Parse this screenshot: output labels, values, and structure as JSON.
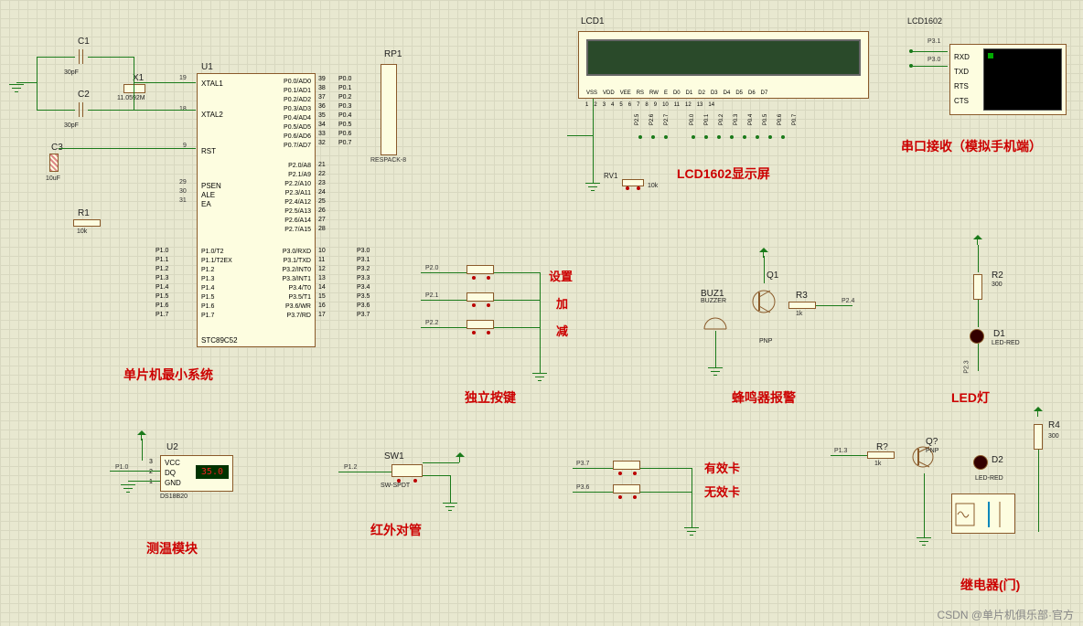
{
  "titles": {
    "mcu": "单片机最小系统",
    "lcd": "LCD1602显示屏",
    "serial": "串口接收（模拟手机端）",
    "buttons": "独立按键",
    "buzzer": "蜂鸣器报警",
    "led": "LED灯",
    "temp": "测温模块",
    "ir": "红外对管",
    "relay": "继电器(门)",
    "cardValid": "有效卡",
    "cardInvalid": "无效卡",
    "btnSet": "设置",
    "btnAdd": "加",
    "btnSub": "减"
  },
  "components": {
    "C1": {
      "ref": "C1",
      "value": "30pF"
    },
    "C2": {
      "ref": "C2",
      "value": "30pF"
    },
    "C3": {
      "ref": "C3",
      "value": "10uF"
    },
    "X1": {
      "ref": "X1",
      "value": "11.0592M"
    },
    "R1": {
      "ref": "R1",
      "value": "10k"
    },
    "R2": {
      "ref": "R2",
      "value": "300"
    },
    "R3": {
      "ref": "R3",
      "value": "1k"
    },
    "R4": {
      "ref": "R4",
      "value": "300"
    },
    "Rq": {
      "ref": "R?",
      "value": "1k"
    },
    "RV1": {
      "ref": "RV1",
      "value": "10k"
    },
    "RP1": {
      "ref": "RP1",
      "value": "RESPACK-8"
    },
    "U1": {
      "ref": "U1",
      "part": "STC89C52"
    },
    "U2": {
      "ref": "U2",
      "part": "DS18B20",
      "display": "35.0"
    },
    "LCD1": {
      "ref": "LCD1",
      "part": "LCD1602"
    },
    "D1": {
      "ref": "D1",
      "value": "LED-RED"
    },
    "D2": {
      "ref": "D2",
      "value": "LED-RED"
    },
    "Q1": {
      "ref": "Q1",
      "value": "PNP"
    },
    "Qq": {
      "ref": "Q?",
      "value": "PNP"
    },
    "BUZ1": {
      "ref": "BUZ1",
      "value": "BUZZER"
    },
    "SW1": {
      "ref": "SW1",
      "value": "SW-SPDT"
    }
  },
  "mcuPins": {
    "left": [
      {
        "num": "19",
        "name": "XTAL1"
      },
      {
        "num": "18",
        "name": "XTAL2"
      },
      {
        "num": "9",
        "name": "RST"
      },
      {
        "num": "29",
        "name": "PSEN"
      },
      {
        "num": "30",
        "name": "ALE"
      },
      {
        "num": "31",
        "name": "EA"
      },
      {
        "num": "",
        "name": "P1.0/T2"
      },
      {
        "num": "",
        "name": "P1.1/T2EX"
      },
      {
        "num": "",
        "name": "P1.2"
      },
      {
        "num": "",
        "name": "P1.3"
      },
      {
        "num": "",
        "name": "P1.4"
      },
      {
        "num": "",
        "name": "P1.5"
      },
      {
        "num": "",
        "name": "P1.6"
      },
      {
        "num": "",
        "name": "P1.7"
      }
    ],
    "right": [
      {
        "num": "39",
        "name": "P0.0/AD0"
      },
      {
        "num": "38",
        "name": "P0.1/AD1"
      },
      {
        "num": "37",
        "name": "P0.2/AD2"
      },
      {
        "num": "36",
        "name": "P0.3/AD3"
      },
      {
        "num": "35",
        "name": "P0.4/AD4"
      },
      {
        "num": "34",
        "name": "P0.5/AD5"
      },
      {
        "num": "33",
        "name": "P0.6/AD6"
      },
      {
        "num": "32",
        "name": "P0.7/AD7"
      },
      {
        "num": "21",
        "name": "P2.0/A8"
      },
      {
        "num": "22",
        "name": "P2.1/A9"
      },
      {
        "num": "23",
        "name": "P2.2/A10"
      },
      {
        "num": "24",
        "name": "P2.3/A11"
      },
      {
        "num": "25",
        "name": "P2.4/A12"
      },
      {
        "num": "26",
        "name": "P2.5/A13"
      },
      {
        "num": "27",
        "name": "P2.6/A14"
      },
      {
        "num": "28",
        "name": "P2.7/A15"
      },
      {
        "num": "10",
        "name": "P3.0/RXD"
      },
      {
        "num": "11",
        "name": "P3.1/TXD"
      },
      {
        "num": "12",
        "name": "P3.2/INT0"
      },
      {
        "num": "13",
        "name": "P3.3/INT1"
      },
      {
        "num": "14",
        "name": "P3.4/T0"
      },
      {
        "num": "15",
        "name": "P3.5/T1"
      },
      {
        "num": "16",
        "name": "P3.6/WR"
      },
      {
        "num": "17",
        "name": "P3.7/RD"
      }
    ],
    "rp1": [
      "P0.0",
      "P0.1",
      "P0.2",
      "P0.3",
      "P0.4",
      "P0.5",
      "P0.6",
      "P0.7"
    ],
    "p1labels": [
      "P1.0",
      "P1.1",
      "P1.2",
      "P1.3",
      "P1.4",
      "P1.5",
      "P1.6",
      "P1.7"
    ],
    "p3labels": [
      "P3.0",
      "P3.1",
      "P3.2",
      "P3.3",
      "P3.4",
      "P3.5",
      "P3.6",
      "P3.7"
    ]
  },
  "lcdPins": {
    "top": [
      "VSS",
      "VDD",
      "VEE",
      "RS",
      "RW",
      "E",
      "D0",
      "D1",
      "D2",
      "D3",
      "D4",
      "D5",
      "D6",
      "D7"
    ],
    "bottomNums": [
      "1",
      "2",
      "3",
      "4",
      "5",
      "6",
      "7",
      "8",
      "9",
      "10",
      "11",
      "12",
      "13",
      "14"
    ],
    "bottomNets": [
      "",
      "",
      "",
      "P2.5",
      "P2.6",
      "P2.7",
      "",
      "P0.0",
      "P0.1",
      "P0.2",
      "P0.3",
      "P0.4",
      "P0.5",
      "P0.6",
      "P0.7"
    ]
  },
  "serialPins": [
    "RXD",
    "TXD",
    "RTS",
    "CTS"
  ],
  "serialNets": [
    "P3.1",
    "P3.0"
  ],
  "buttonPins": [
    "P2.0",
    "P2.1",
    "P2.2"
  ],
  "u2Pins": [
    "VCC",
    "DQ",
    "GND"
  ],
  "u2Nums": [
    "3",
    "2",
    "1"
  ],
  "netLabels": {
    "sw1": "P1.2",
    "card1": "P3.7",
    "card2": "P3.6",
    "buz": "P2.4",
    "led": "P2.3",
    "relay": "P1.3",
    "temp": "P1.0"
  },
  "watermark": "CSDN @单片机俱乐部·官方"
}
